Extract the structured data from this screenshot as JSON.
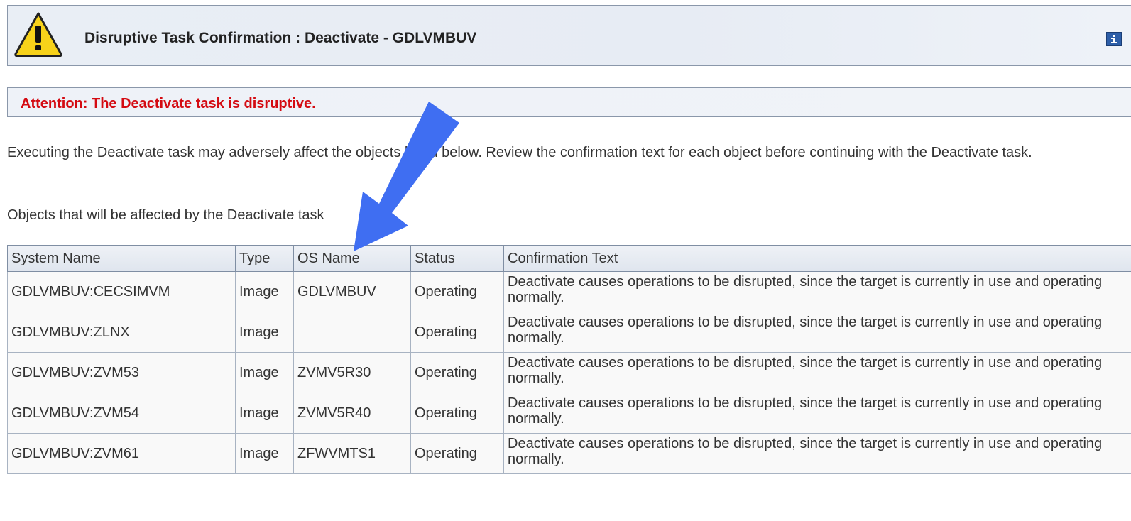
{
  "header": {
    "title": "Disruptive Task Confirmation : Deactivate - GDLVMBUV",
    "warning_icon": "warning-triangle-icon",
    "help_icon": "info-icon"
  },
  "attention": {
    "text": "Attention: The Deactivate task is disruptive.",
    "color": "#d40b12"
  },
  "description": "Executing the Deactivate task may adversely affect the objects listed below. Review the confirmation text for each object before continuing with the Deactivate task.",
  "objects_label": "Objects that will be affected by the Deactivate task",
  "table": {
    "columns": [
      "System Name",
      "Type",
      "OS Name",
      "Status",
      "Confirmation Text"
    ],
    "rows": [
      [
        "GDLVMBUV:CECSIMVM",
        "Image",
        "GDLVMBUV",
        "Operating",
        "Deactivate causes operations to be disrupted, since the target is currently in use and operating normally."
      ],
      [
        "GDLVMBUV:ZLNX",
        "Image",
        "",
        "Operating",
        "Deactivate causes operations to be disrupted, since the target is currently in use and operating normally."
      ],
      [
        "GDLVMBUV:ZVM53",
        "Image",
        "ZVMV5R30",
        "Operating",
        "Deactivate causes operations to be disrupted, since the target is currently in use and operating normally."
      ],
      [
        "GDLVMBUV:ZVM54",
        "Image",
        "ZVMV5R40",
        "Operating",
        "Deactivate causes operations to be disrupted, since the target is currently in use and operating normally."
      ],
      [
        "GDLVMBUV:ZVM61",
        "Image",
        "ZFWVMTS1",
        "Operating",
        "Deactivate causes operations to be disrupted, since the target is currently in use and operating normally."
      ]
    ]
  },
  "annotation": {
    "arrow_icon": "blue-arrow-annotation-icon",
    "color": "#3f6ef2"
  }
}
